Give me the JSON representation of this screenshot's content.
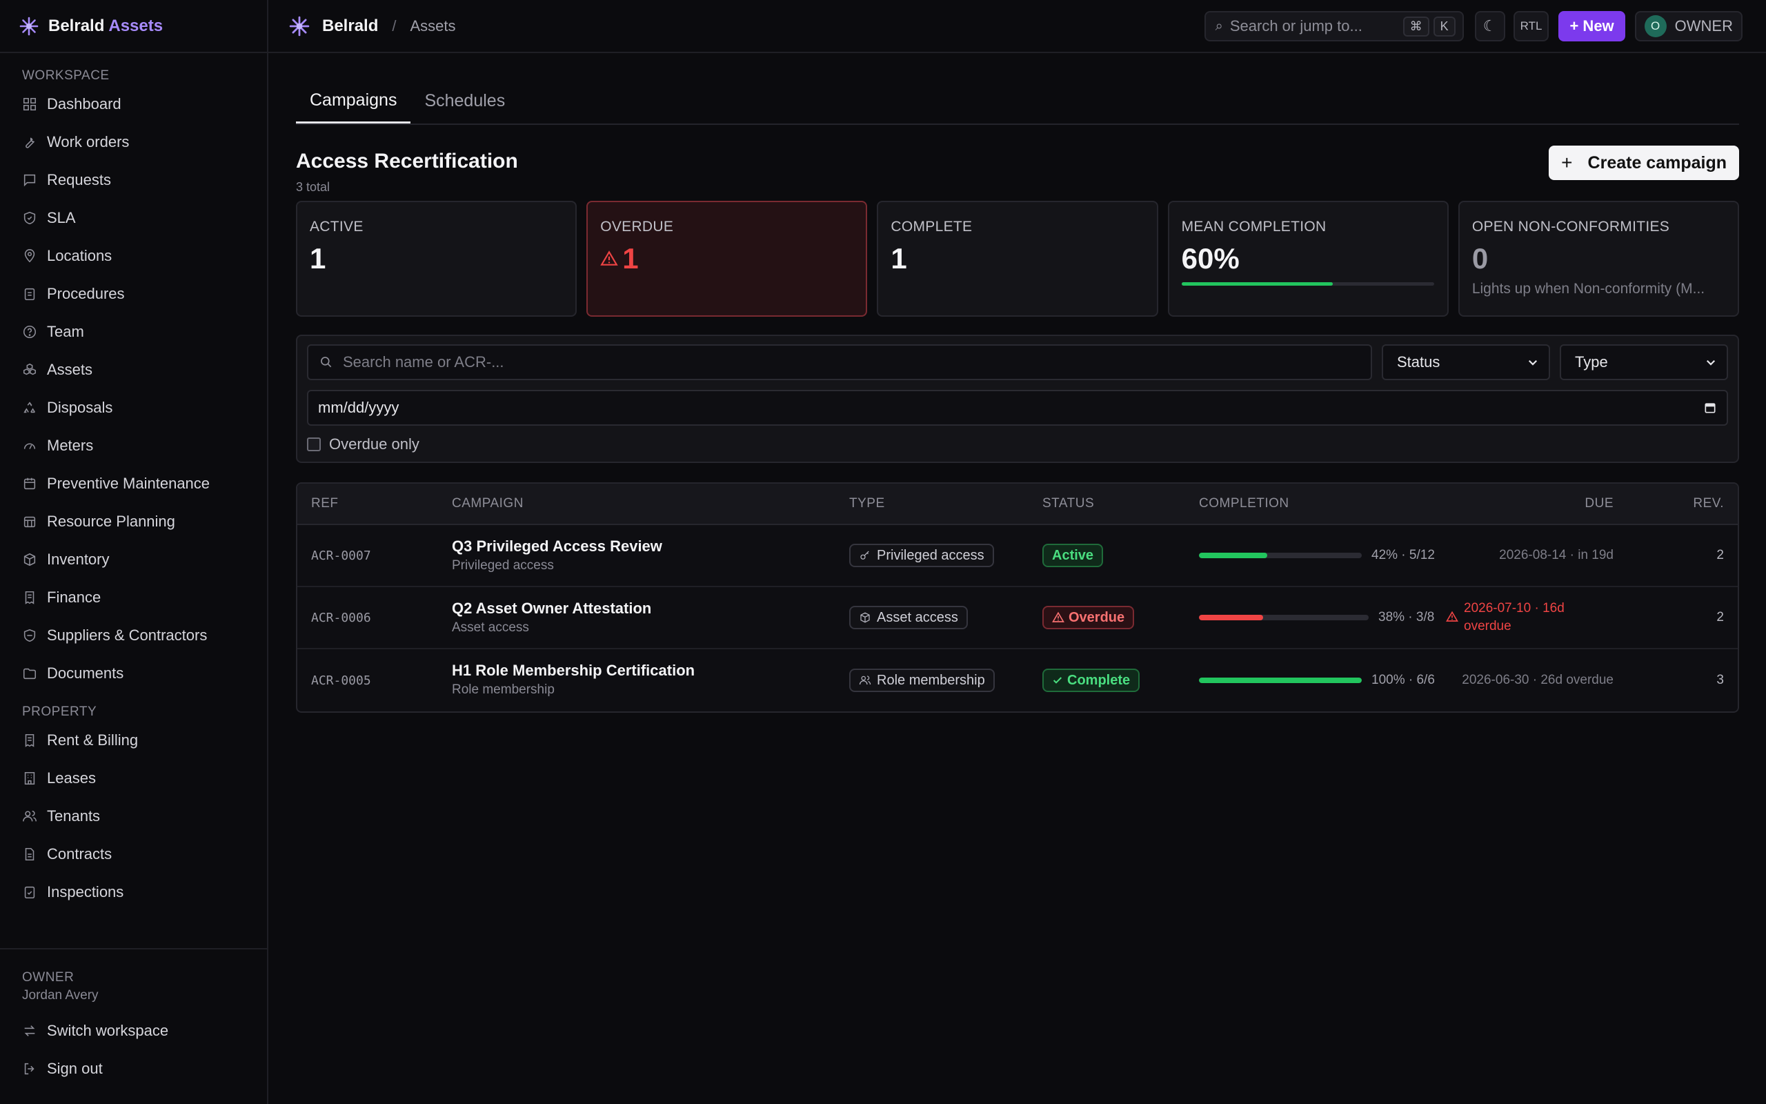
{
  "brand": {
    "name": "Belrald",
    "accent": "Assets"
  },
  "sidebar": {
    "workspace_title": "WORKSPACE",
    "workspace_items": [
      {
        "label": "Dashboard",
        "icon": "grid-icon"
      },
      {
        "label": "Work orders",
        "icon": "wrench-icon"
      },
      {
        "label": "Requests",
        "icon": "chat-icon"
      },
      {
        "label": "SLA",
        "icon": "shield-icon"
      },
      {
        "label": "Locations",
        "icon": "pin-icon"
      },
      {
        "label": "Procedures",
        "icon": "clipboard-icon"
      },
      {
        "label": "Team",
        "icon": "question-icon"
      },
      {
        "label": "Assets",
        "icon": "boxes-icon"
      },
      {
        "label": "Disposals",
        "icon": "recycle-icon"
      },
      {
        "label": "Meters",
        "icon": "gauge-icon"
      },
      {
        "label": "Preventive Maintenance",
        "icon": "calendar-icon"
      },
      {
        "label": "Resource Planning",
        "icon": "calendar-grid-icon"
      },
      {
        "label": "Inventory",
        "icon": "package-icon"
      },
      {
        "label": "Finance",
        "icon": "receipt-icon"
      },
      {
        "label": "Suppliers & Contractors",
        "icon": "handshake-icon"
      },
      {
        "label": "Documents",
        "icon": "folder-icon"
      }
    ],
    "property_title": "PROPERTY",
    "property_items": [
      {
        "label": "Rent & Billing",
        "icon": "receipt-icon"
      },
      {
        "label": "Leases",
        "icon": "building-icon"
      },
      {
        "label": "Tenants",
        "icon": "users-icon"
      },
      {
        "label": "Contracts",
        "icon": "file-icon"
      },
      {
        "label": "Inspections",
        "icon": "clipboard-check-icon"
      }
    ],
    "owner_label": "OWNER",
    "owner_name": "Jordan Avery",
    "switch_workspace": "Switch workspace",
    "sign_out": "Sign out"
  },
  "topbar": {
    "crumb_main": "Belrald",
    "crumb_sep": "/",
    "crumb_sub": "Assets",
    "search_placeholder": "Search or jump to...",
    "kbd_cmd": "⌘",
    "kbd_k": "K",
    "rtl": "RTL",
    "new_label": "+ New",
    "avatar_letter": "O",
    "owner_role": "OWNER"
  },
  "tabs": [
    "Campaigns",
    "Schedules"
  ],
  "page": {
    "title": "Access Recertification",
    "subtitle": "3 total",
    "create_label": "Create campaign"
  },
  "stats": {
    "active": {
      "label": "ACTIVE",
      "value": "1"
    },
    "overdue": {
      "label": "OVERDUE",
      "value": "1"
    },
    "complete": {
      "label": "COMPLETE",
      "value": "1"
    },
    "mean": {
      "label": "MEAN COMPLETION",
      "value": "60%",
      "fraction": 0.6
    },
    "nonconf": {
      "label": "OPEN NON-CONFORMITIES",
      "value": "0",
      "note": "Lights up when Non-conformity (M..."
    }
  },
  "filters": {
    "search_placeholder": "Search name or ACR-...",
    "status_label": "Status",
    "type_label": "Type",
    "date_placeholder": "mm/dd/yyyy",
    "overdue_only": "Overdue only"
  },
  "table": {
    "headers": {
      "ref": "REF",
      "campaign": "CAMPAIGN",
      "type": "TYPE",
      "status": "STATUS",
      "completion": "COMPLETION",
      "due": "DUE",
      "rev": "REV."
    },
    "rows": [
      {
        "ref": "ACR-0007",
        "name": "Q3 Privileged Access Review",
        "sub": "Privileged access",
        "type": "Privileged access",
        "status": "Active",
        "pct": "42% · 5/12",
        "due": "2026-08-14 · in 19d",
        "rev": "2"
      },
      {
        "ref": "ACR-0006",
        "name": "Q2 Asset Owner Attestation",
        "sub": "Asset access",
        "type": "Asset access",
        "status": "Overdue",
        "pct": "38% · 3/8",
        "due_line1": "2026-07-10 · 16d",
        "due_line2": "overdue",
        "rev": "2"
      },
      {
        "ref": "ACR-0005",
        "name": "H1 Role Membership Certification",
        "sub": "Role membership",
        "type": "Role membership",
        "status": "Complete",
        "pct": "100% · 6/6",
        "due": "2026-06-30 · 26d overdue",
        "rev": "3"
      }
    ]
  },
  "colors": {
    "accent": "#7c3aed",
    "brand_accent": "#a78bfa",
    "success": "#22c55e",
    "danger": "#ef4444"
  }
}
